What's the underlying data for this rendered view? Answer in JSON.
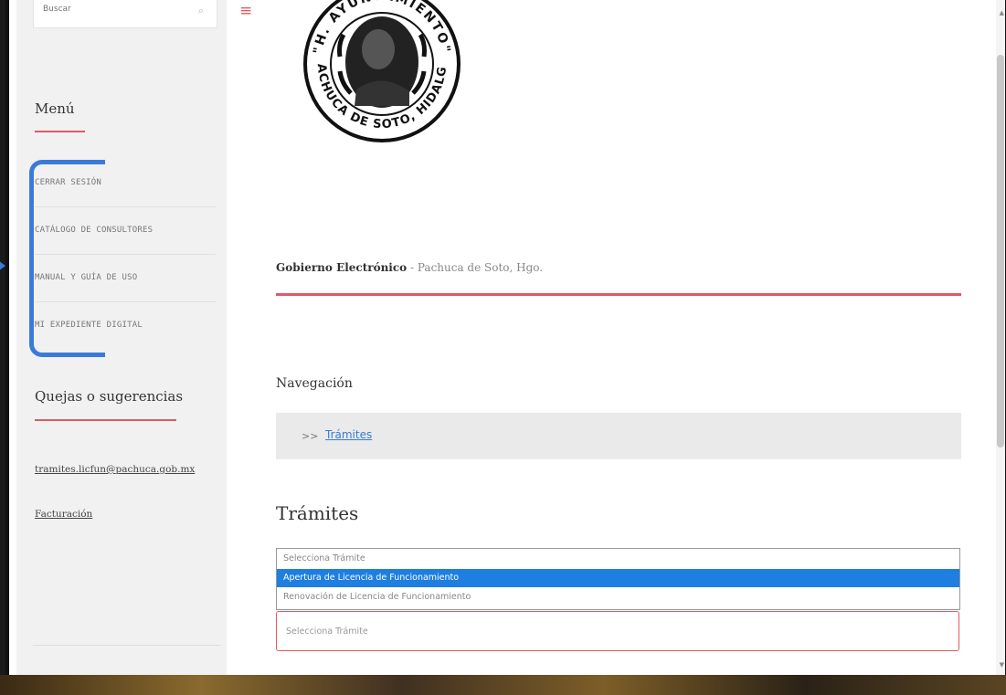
{
  "search": {
    "placeholder": "Buscar"
  },
  "sidebar": {
    "menu_title": "Menú",
    "items": [
      {
        "label": "CERRAR SESIÓN"
      },
      {
        "label": "CATÁLOGO DE CONSULTORES"
      },
      {
        "label": "MANUAL Y GUÍA DE USO"
      },
      {
        "label": "MI EXPEDIENTE DIGITAL"
      }
    ],
    "complaints_title": "Quejas o sugerencias",
    "links": [
      {
        "label": "tramites.licfun@pachuca.gob.mx"
      },
      {
        "label": "Facturación"
      }
    ]
  },
  "seal": {
    "top_text": "\"H. AYUNTAMIENTO\"",
    "bottom_text": "PACHUCA DE SOTO, HIDALGO"
  },
  "header": {
    "bold": "Gobierno Electrónico",
    "sep": " - ",
    "rest": "Pachuca de Soto, Hgo."
  },
  "nav": {
    "title": "Navegación",
    "separator": ">>",
    "crumb": "Trámites"
  },
  "tramites": {
    "title": "Trámites",
    "options": [
      "Selecciona Trámite",
      "Apertura de Licencia de Funcionamiento",
      "Renovación de Licencia de Funcionamiento"
    ],
    "selected_index": 1,
    "select_value": "Selecciona Trámite"
  },
  "colors": {
    "accent": "#e05a63",
    "highlight": "#1e7fe0",
    "annotation": "#3a7bd8"
  }
}
